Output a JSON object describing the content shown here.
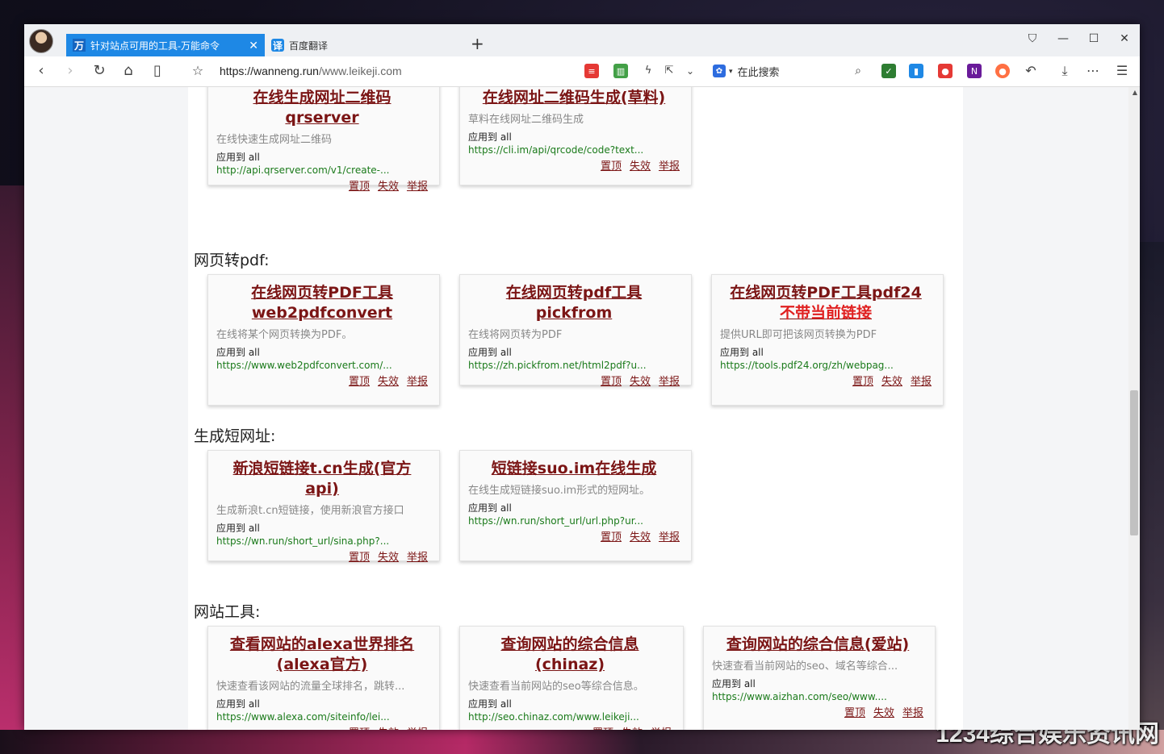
{
  "browser": {
    "tabs": [
      {
        "icon": "万",
        "label": "针对站点可用的工具-万能命令",
        "active": true
      },
      {
        "icon": "译",
        "label": "百度翻译",
        "active": false
      }
    ],
    "url_main": "https://wanneng.run",
    "url_path": "/www.leikeji.com",
    "search_placeholder": "在此搜索"
  },
  "watermark": "1234综合娱乐资讯网",
  "page": {
    "top_cards": [
      {
        "title": "在线生成网址二维码qrserver",
        "desc": "在线快速生成网址二维码",
        "apply": "应用到 all",
        "url": "http://api.qrserver.com/v1/create-...",
        "actions": [
          "置顶",
          "失效",
          "举报"
        ]
      },
      {
        "title": "在线网址二维码生成(草料)",
        "desc": "草料在线网址二维码生成",
        "apply": "应用到 all",
        "url": "https://cli.im/api/qrcode/code?text...",
        "actions": [
          "置顶",
          "失效",
          "举报"
        ]
      }
    ],
    "sections": [
      {
        "title": "网页转pdf:",
        "cards": [
          {
            "title": "在线网页转PDF工具web2pdfconvert",
            "desc": "在线将某个网页转换为PDF。",
            "apply": "应用到 all",
            "url": "https://www.web2pdfconvert.com/...",
            "actions": [
              "置顶",
              "失效",
              "举报"
            ]
          },
          {
            "title": "在线网页转pdf工具pickfrom",
            "desc": "在线将网页转为PDF",
            "apply": "应用到 all",
            "url": "https://zh.pickfrom.net/html2pdf?u...",
            "actions": [
              "置顶",
              "失效",
              "举报"
            ]
          },
          {
            "title": "在线网页转PDF工具pdf24",
            "title_red": "不带当前链接",
            "desc": "提供URL即可把该网页转换为PDF",
            "apply": "应用到 all",
            "url": "https://tools.pdf24.org/zh/webpag...",
            "actions": [
              "置顶",
              "失效",
              "举报"
            ]
          }
        ]
      },
      {
        "title": "生成短网址:",
        "cards": [
          {
            "title": "新浪短链接t.cn生成(官方api)",
            "desc": "生成新浪t.cn短链接，使用新浪官方接口",
            "apply": "应用到 all",
            "url": "https://wn.run/short_url/sina.php?...",
            "actions": [
              "置顶",
              "失效",
              "举报"
            ]
          },
          {
            "title": "短链接suo.im在线生成",
            "desc": "在线生成短链接suo.im形式的短网址。",
            "apply": "应用到 all",
            "url": "https://wn.run/short_url/url.php?ur...",
            "actions": [
              "置顶",
              "失效",
              "举报"
            ]
          }
        ]
      },
      {
        "title": "网站工具:",
        "cards": [
          {
            "title": "查看网站的alexa世界排名(alexa官方)",
            "desc": "快速查看该网站的流量全球排名，跳转...",
            "apply": "应用到 all",
            "url": "https://www.alexa.com/siteinfo/lei...",
            "actions": [
              "置顶",
              "失效",
              "举报"
            ]
          },
          {
            "title": "查询网站的综合信息(chinaz)",
            "desc": "快速查看当前网站的seo等综合信息。",
            "apply": "应用到 all",
            "url": "http://seo.chinaz.com/www.leikeji...",
            "actions": [
              "置顶",
              "失效",
              "举报"
            ]
          },
          {
            "title": "查询网站的综合信息(爱站)",
            "desc": "快速查看当前网站的seo、域名等综合...",
            "apply": "应用到 all",
            "url": "https://www.aizhan.com/seo/www....",
            "actions": [
              "置顶",
              "失效",
              "举报"
            ]
          }
        ]
      }
    ]
  }
}
